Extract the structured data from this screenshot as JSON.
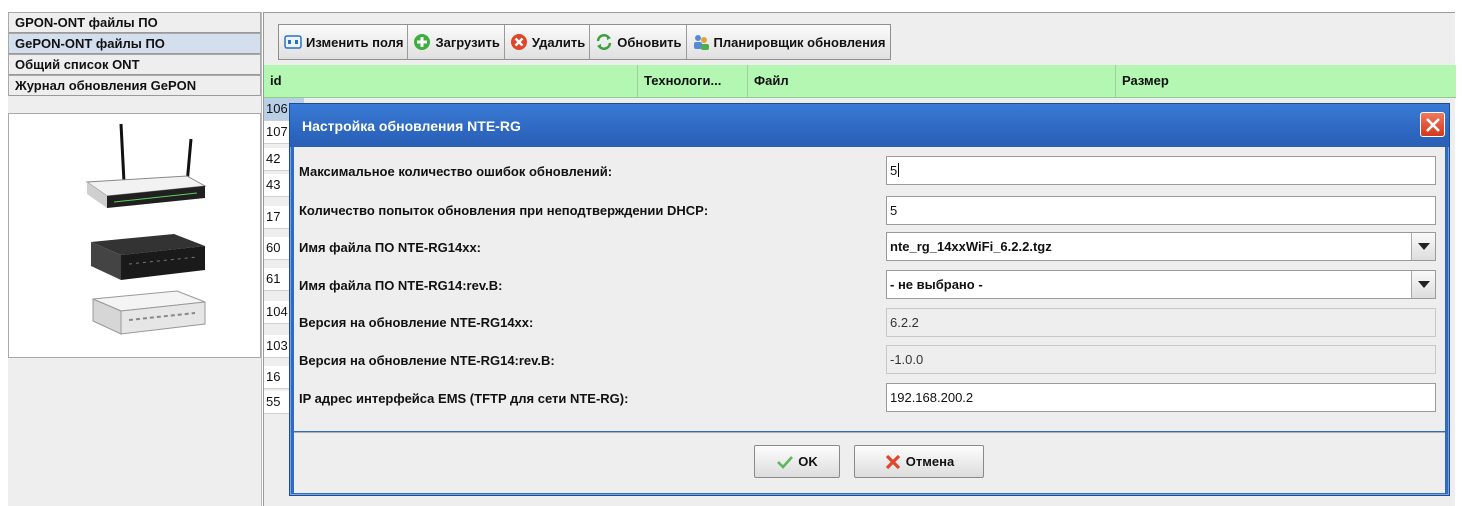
{
  "sidebar": {
    "items": [
      {
        "label": "GPON-ONT файлы ПО"
      },
      {
        "label": "GePON-ONT файлы ПО"
      },
      {
        "label": "Общий список ONT"
      },
      {
        "label": "Журнал обновления GePON"
      }
    ],
    "selected_index": 1
  },
  "toolbar": {
    "buttons": [
      {
        "label": "Изменить поля",
        "icon": "edit-fields-icon"
      },
      {
        "label": "Загрузить",
        "icon": "add-icon"
      },
      {
        "label": "Удалить",
        "icon": "delete-icon"
      },
      {
        "label": "Обновить",
        "icon": "refresh-icon"
      },
      {
        "label": "Планировщик обновления",
        "icon": "scheduler-icon"
      }
    ]
  },
  "table": {
    "columns": [
      "id",
      "Технологи...",
      "Файл",
      "Размер"
    ],
    "ids": [
      "106",
      "107",
      "42",
      "43",
      "17",
      "60",
      "61",
      "104",
      "103",
      "16",
      "55"
    ]
  },
  "dialog": {
    "title": "Настройка обновления NTE-RG",
    "fields": [
      {
        "label": "Максимальное количество ошибок обновлений:",
        "value": "5"
      },
      {
        "label": "Количество попыток обновления при неподтверждении DHCP:",
        "value": "5"
      },
      {
        "label": "Имя файла ПО NTE-RG14xx:",
        "value": "nte_rg_14xxWiFi_6.2.2.tgz"
      },
      {
        "label": "Имя файла ПО NTE-RG14:rev.B:",
        "value": "- не выбрано -"
      },
      {
        "label": "Версия на обновление NTE-RG14xx:",
        "value": "6.2.2"
      },
      {
        "label": "Версия на обновление NTE-RG14:rev.B:",
        "value": "-1.0.0"
      },
      {
        "label": "IP адрес интерфейса EMS (TFTP для сети NTE-RG):",
        "value": "192.168.200.2"
      }
    ],
    "ok_label": "OK",
    "cancel_label": "Отмена"
  },
  "colors": {
    "header_green": "#b3f7b3",
    "title_blue": "#2e68c2",
    "close_red": "#d2381a",
    "selected_row": "#b8cfe5"
  }
}
